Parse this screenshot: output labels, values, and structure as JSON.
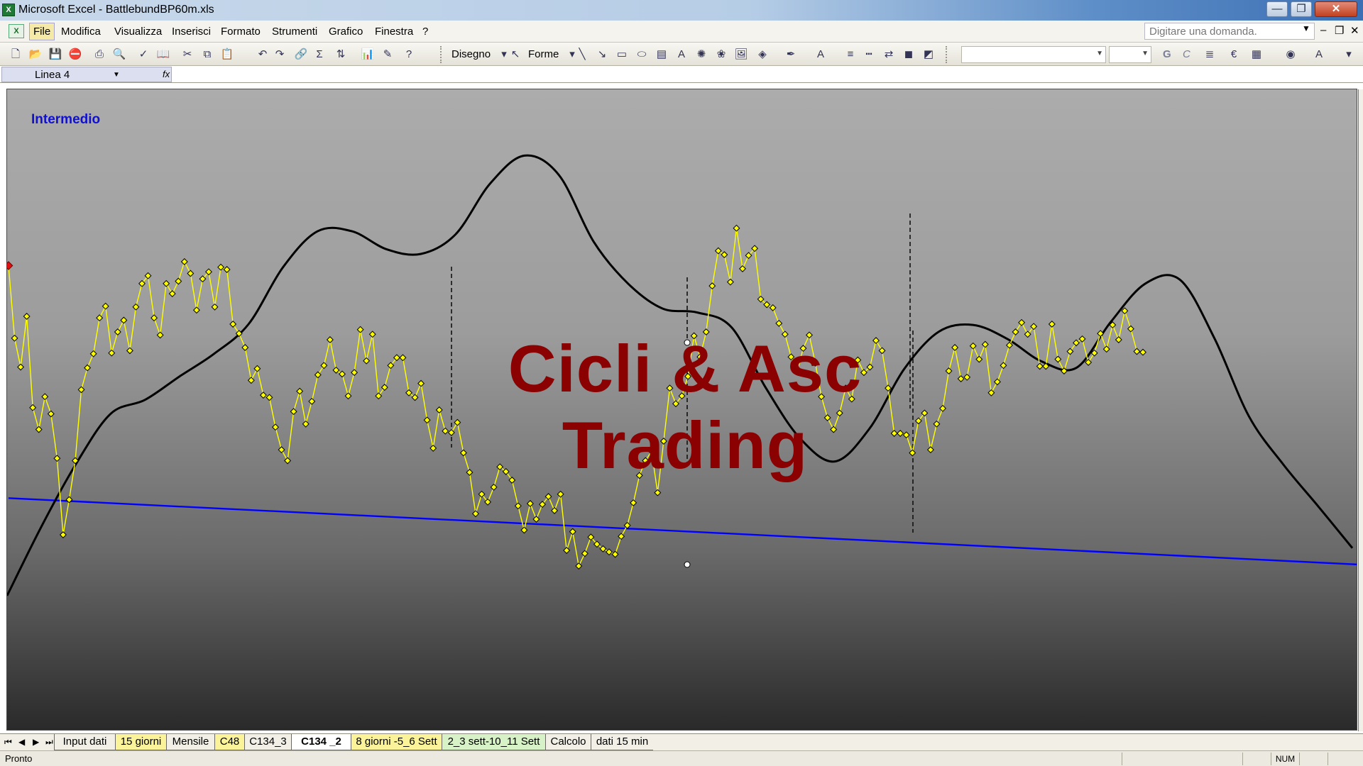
{
  "window": {
    "title": "Microsoft Excel - BattlebundBP60m.xls",
    "app_icon": "excel-icon",
    "buttons": {
      "minimize": "—",
      "maximize": "❐",
      "close": "✕"
    }
  },
  "menu": {
    "items": [
      "File",
      "Modifica",
      "Visualizza",
      "Inserisci",
      "Formato",
      "Strumenti",
      "Grafico",
      "Finestra",
      "?"
    ],
    "active": "File",
    "help_placeholder": "Digitare una domanda.",
    "mdi_controls": [
      "–",
      "❐",
      "✕"
    ]
  },
  "toolbar": {
    "disegno_label": "Disegno",
    "forme_label": "Forme",
    "bold_label": "G",
    "italic_label": "C"
  },
  "formula_bar": {
    "name_box": "Linea 4",
    "fx_label": "fx"
  },
  "chart": {
    "label": "Intermedio",
    "label_color": "#1111cc",
    "watermark_line1": "Cicli & Asc",
    "watermark_line2": "Trading",
    "watermark_color": "#8b0000",
    "price_color": "#ffff00",
    "cycle_color": "#000000",
    "trend_color": "#0000ff"
  },
  "chart_data": {
    "type": "line",
    "series": [
      {
        "role": "price",
        "values": [
          465,
          372,
          335,
          400,
          283,
          255,
          297,
          275,
          218,
          120,
          165,
          215,
          306,
          334,
          352,
          398,
          413,
          353,
          380,
          395,
          356,
          412,
          442,
          452,
          398,
          376,
          442,
          429,
          445,
          470,
          455,
          408,
          448,
          457,
          412,
          463,
          460,
          390,
          378,
          360,
          318,
          333,
          299,
          296,
          258,
          229,
          215,
          278,
          304,
          262,
          291,
          325,
          337,
          370,
          331,
          326,
          298,
          328,
          383,
          343,
          377,
          298,
          309,
          337,
          347,
          347,
          302,
          296,
          314,
          267,
          231,
          280,
          253,
          251,
          264,
          225,
          200,
          147,
          172,
          162,
          181,
          207,
          201,
          190,
          157,
          126,
          160,
          140,
          159,
          169,
          151,
          172,
          100,
          124,
          80,
          96,
          117,
          108,
          102,
          98,
          95,
          118,
          132,
          161,
          196,
          215,
          227,
          174,
          240,
          308,
          288,
          298,
          323,
          375,
          348,
          380,
          439,
          484,
          479,
          444,
          513,
          461,
          478,
          487,
          422,
          415,
          411,
          391,
          377,
          348,
          329,
          359,
          376,
          340,
          297,
          270,
          255,
          276,
          308,
          294,
          344,
          328,
          335,
          369,
          356,
          308,
          250,
          250,
          248,
          225,
          266,
          276,
          229,
          262,
          282,
          330,
          360,
          320,
          322,
          362,
          345,
          364,
          302,
          316,
          337,
          363,
          380,
          392,
          377,
          387,
          336,
          336,
          390,
          345,
          330,
          355,
          366,
          371,
          341,
          353,
          378,
          358,
          389,
          370,
          407,
          384,
          355,
          354
        ]
      },
      {
        "role": "cycle",
        "values": [
          42,
          131,
          211,
          275,
          293,
          323,
          352,
          390,
          463,
          509,
          509,
          486,
          480,
          505,
          570,
          606,
          581,
          496,
          442,
          410,
          405,
          386,
          308,
          243,
          214,
          256,
          332,
          380,
          389,
          371,
          342,
          334,
          393,
          442,
          447,
          372,
          272,
          210,
          157,
          103
        ]
      },
      {
        "role": "trend",
        "values": [
          100,
          0
        ]
      }
    ],
    "markers": {
      "vertical_lines": 4
    }
  },
  "tabs": [
    {
      "label": "Input dati",
      "style": "plain"
    },
    {
      "label": "15 giorni",
      "style": "yellow"
    },
    {
      "label": "Mensile",
      "style": "plain"
    },
    {
      "label": "C48",
      "style": "yellow"
    },
    {
      "label": "C134_3",
      "style": "plain"
    },
    {
      "label": "C134 _2",
      "style": "active"
    },
    {
      "label": "8 giorni -5_6 Sett",
      "style": "yellow"
    },
    {
      "label": "2_3 sett-10_11 Sett",
      "style": "green"
    },
    {
      "label": "Calcolo",
      "style": "plain"
    },
    {
      "label": "dati 15 min",
      "style": "plain"
    }
  ],
  "status": {
    "text": "Pronto",
    "num_indicator": "NUM"
  }
}
